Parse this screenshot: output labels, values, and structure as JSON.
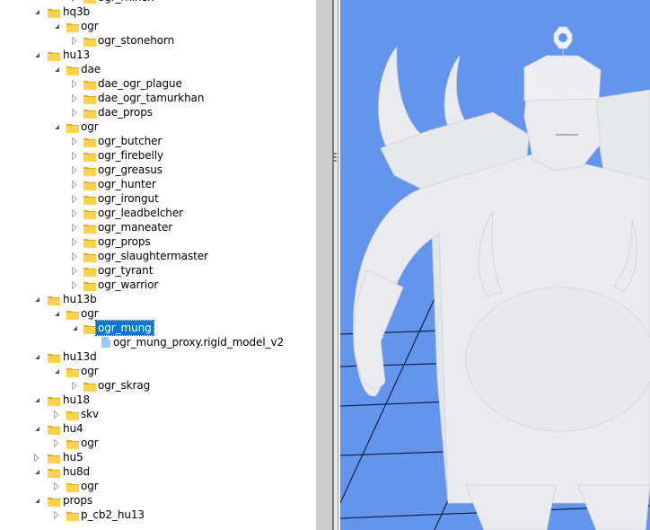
{
  "tree": {
    "selected_node": "ogr_mung",
    "nodes": [
      {
        "label": "ogr_rhinox",
        "depth": 2,
        "type": "folder",
        "state": "collapsed"
      },
      {
        "label": "hq3b",
        "depth": 0,
        "type": "folder",
        "state": "expanded"
      },
      {
        "label": "ogr",
        "depth": 1,
        "type": "folder",
        "state": "expanded"
      },
      {
        "label": "ogr_stonehorn",
        "depth": 2,
        "type": "folder",
        "state": "collapsed"
      },
      {
        "label": "hu13",
        "depth": 0,
        "type": "folder",
        "state": "expanded"
      },
      {
        "label": "dae",
        "depth": 1,
        "type": "folder",
        "state": "expanded"
      },
      {
        "label": "dae_ogr_plague",
        "depth": 2,
        "type": "folder",
        "state": "collapsed"
      },
      {
        "label": "dae_ogr_tamurkhan",
        "depth": 2,
        "type": "folder",
        "state": "collapsed"
      },
      {
        "label": "dae_props",
        "depth": 2,
        "type": "folder",
        "state": "collapsed"
      },
      {
        "label": "ogr",
        "depth": 1,
        "type": "folder",
        "state": "expanded"
      },
      {
        "label": "ogr_butcher",
        "depth": 2,
        "type": "folder",
        "state": "collapsed"
      },
      {
        "label": "ogr_firebelly",
        "depth": 2,
        "type": "folder",
        "state": "collapsed"
      },
      {
        "label": "ogr_greasus",
        "depth": 2,
        "type": "folder",
        "state": "collapsed"
      },
      {
        "label": "ogr_hunter",
        "depth": 2,
        "type": "folder",
        "state": "collapsed"
      },
      {
        "label": "ogr_irongut",
        "depth": 2,
        "type": "folder",
        "state": "collapsed"
      },
      {
        "label": "ogr_leadbelcher",
        "depth": 2,
        "type": "folder",
        "state": "collapsed"
      },
      {
        "label": "ogr_maneater",
        "depth": 2,
        "type": "folder",
        "state": "collapsed"
      },
      {
        "label": "ogr_props",
        "depth": 2,
        "type": "folder",
        "state": "collapsed"
      },
      {
        "label": "ogr_slaughtermaster",
        "depth": 2,
        "type": "folder",
        "state": "collapsed"
      },
      {
        "label": "ogr_tyrant",
        "depth": 2,
        "type": "folder",
        "state": "collapsed"
      },
      {
        "label": "ogr_warrior",
        "depth": 2,
        "type": "folder",
        "state": "collapsed"
      },
      {
        "label": "hu13b",
        "depth": 0,
        "type": "folder",
        "state": "expanded"
      },
      {
        "label": "ogr",
        "depth": 1,
        "type": "folder",
        "state": "expanded"
      },
      {
        "label": "ogr_mung",
        "depth": 2,
        "type": "folder",
        "state": "expanded",
        "selected": true
      },
      {
        "label": "ogr_mung_proxy.rigid_model_v2",
        "depth": 3,
        "type": "file",
        "state": "leaf"
      },
      {
        "label": "hu13d",
        "depth": 0,
        "type": "folder",
        "state": "expanded"
      },
      {
        "label": "ogr",
        "depth": 1,
        "type": "folder",
        "state": "expanded"
      },
      {
        "label": "ogr_skrag",
        "depth": 2,
        "type": "folder",
        "state": "collapsed"
      },
      {
        "label": "hu18",
        "depth": 0,
        "type": "folder",
        "state": "expanded"
      },
      {
        "label": "skv",
        "depth": 1,
        "type": "folder",
        "state": "collapsed"
      },
      {
        "label": "hu4",
        "depth": 0,
        "type": "folder",
        "state": "expanded"
      },
      {
        "label": "ogr",
        "depth": 1,
        "type": "folder",
        "state": "collapsed"
      },
      {
        "label": "hu5",
        "depth": 0,
        "type": "folder",
        "state": "collapsed"
      },
      {
        "label": "hu8d",
        "depth": 0,
        "type": "folder",
        "state": "expanded"
      },
      {
        "label": "ogr",
        "depth": 1,
        "type": "folder",
        "state": "collapsed"
      },
      {
        "label": "props",
        "depth": 0,
        "type": "folder",
        "state": "expanded"
      },
      {
        "label": "p_cb2_hu13",
        "depth": 1,
        "type": "folder",
        "state": "collapsed"
      }
    ]
  },
  "viewport": {
    "model_name": "ogr_mung_proxy.rigid_model_v2",
    "background_color": "#6495ed",
    "grid_color": "#0a1a3a",
    "model_color": "#e9ebee"
  },
  "colors": {
    "folder": "#ffd24d",
    "folder_dark": "#e8b00a",
    "file": "#9cc9f5",
    "selection": "#0078d7",
    "expander": "#555555"
  }
}
